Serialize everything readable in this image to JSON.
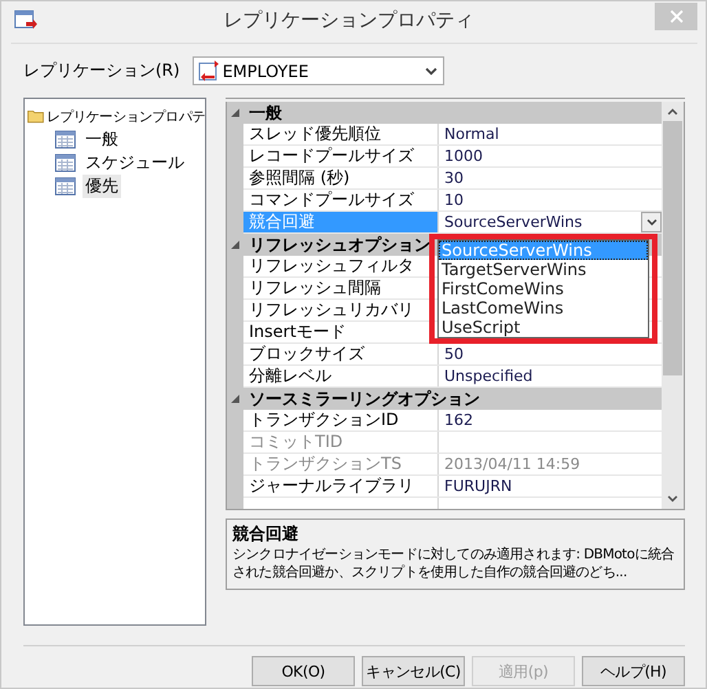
{
  "window": {
    "title": "レプリケーションプロパティ"
  },
  "replication": {
    "label": "レプリケーション(R)",
    "value": "EMPLOYEE"
  },
  "tree": {
    "label": "レプリケーションプロパテ",
    "children": [
      {
        "label": "一般",
        "selected": false
      },
      {
        "label": "スケジュール",
        "selected": false
      },
      {
        "label": "優先",
        "selected": true
      }
    ]
  },
  "sections": [
    {
      "title": "一般",
      "expanded": true,
      "rows": [
        {
          "name": "スレッド優先順位",
          "value": "Normal",
          "disabled": false,
          "selected": false
        },
        {
          "name": "レコードプールサイズ",
          "value": "1000",
          "disabled": false,
          "selected": false
        },
        {
          "name": "参照間隔 (秒)",
          "value": "30",
          "disabled": false,
          "selected": false
        },
        {
          "name": "コマンドプールサイズ",
          "value": "10",
          "disabled": false,
          "selected": false
        },
        {
          "name": "競合回避",
          "value": "SourceServerWins",
          "disabled": false,
          "selected": true
        }
      ]
    },
    {
      "title": "リフレッシュオプション",
      "expanded": true,
      "rows": [
        {
          "name": "リフレッシュフィルタ",
          "value": "",
          "disabled": false,
          "selected": false
        },
        {
          "name": "リフレッシュ間隔",
          "value": "",
          "disabled": false,
          "selected": false
        },
        {
          "name": "リフレッシュリカバリ",
          "value": "",
          "disabled": false,
          "selected": false
        },
        {
          "name": "Insertモード",
          "value": "",
          "disabled": false,
          "selected": false
        },
        {
          "name": "ブロックサイズ",
          "value": "50",
          "disabled": false,
          "selected": false
        },
        {
          "name": "分離レベル",
          "value": "Unspecified",
          "disabled": false,
          "selected": false
        }
      ]
    },
    {
      "title": "ソースミラーリングオプション",
      "expanded": true,
      "rows": [
        {
          "name": "トランザクションID",
          "value": "162",
          "disabled": false,
          "selected": false
        },
        {
          "name": "コミットTID",
          "value": "",
          "disabled": true,
          "selected": false
        },
        {
          "name": "トランザクションTS",
          "value": "2013/04/11 14:59",
          "disabled": true,
          "selected": false
        },
        {
          "name": "ジャーナルライブラリ",
          "value": "FURUJRN",
          "disabled": false,
          "selected": false
        },
        {
          "name": "",
          "value": "",
          "disabled": false,
          "selected": false
        }
      ]
    }
  ],
  "dropdown": {
    "open": true,
    "options": [
      {
        "label": "SourceServerWins",
        "selected": true
      },
      {
        "label": "TargetServerWins",
        "selected": false
      },
      {
        "label": "FirstComeWins",
        "selected": false
      },
      {
        "label": "LastComeWins",
        "selected": false
      },
      {
        "label": "UseScript",
        "selected": false
      }
    ]
  },
  "description": {
    "title": "競合回避",
    "text": "シンクロナイゼーションモードに対してのみ適用されます: DBMotoに統合された競合回避か、スクリプトを使用した自作の競合回避のどち..."
  },
  "buttons": [
    {
      "label": "OK(O)",
      "disabled": false
    },
    {
      "label": "キャンセル(C)",
      "disabled": false
    },
    {
      "label": "適用(p)",
      "disabled": true
    },
    {
      "label": "ヘルプ(H)",
      "disabled": false
    }
  ]
}
